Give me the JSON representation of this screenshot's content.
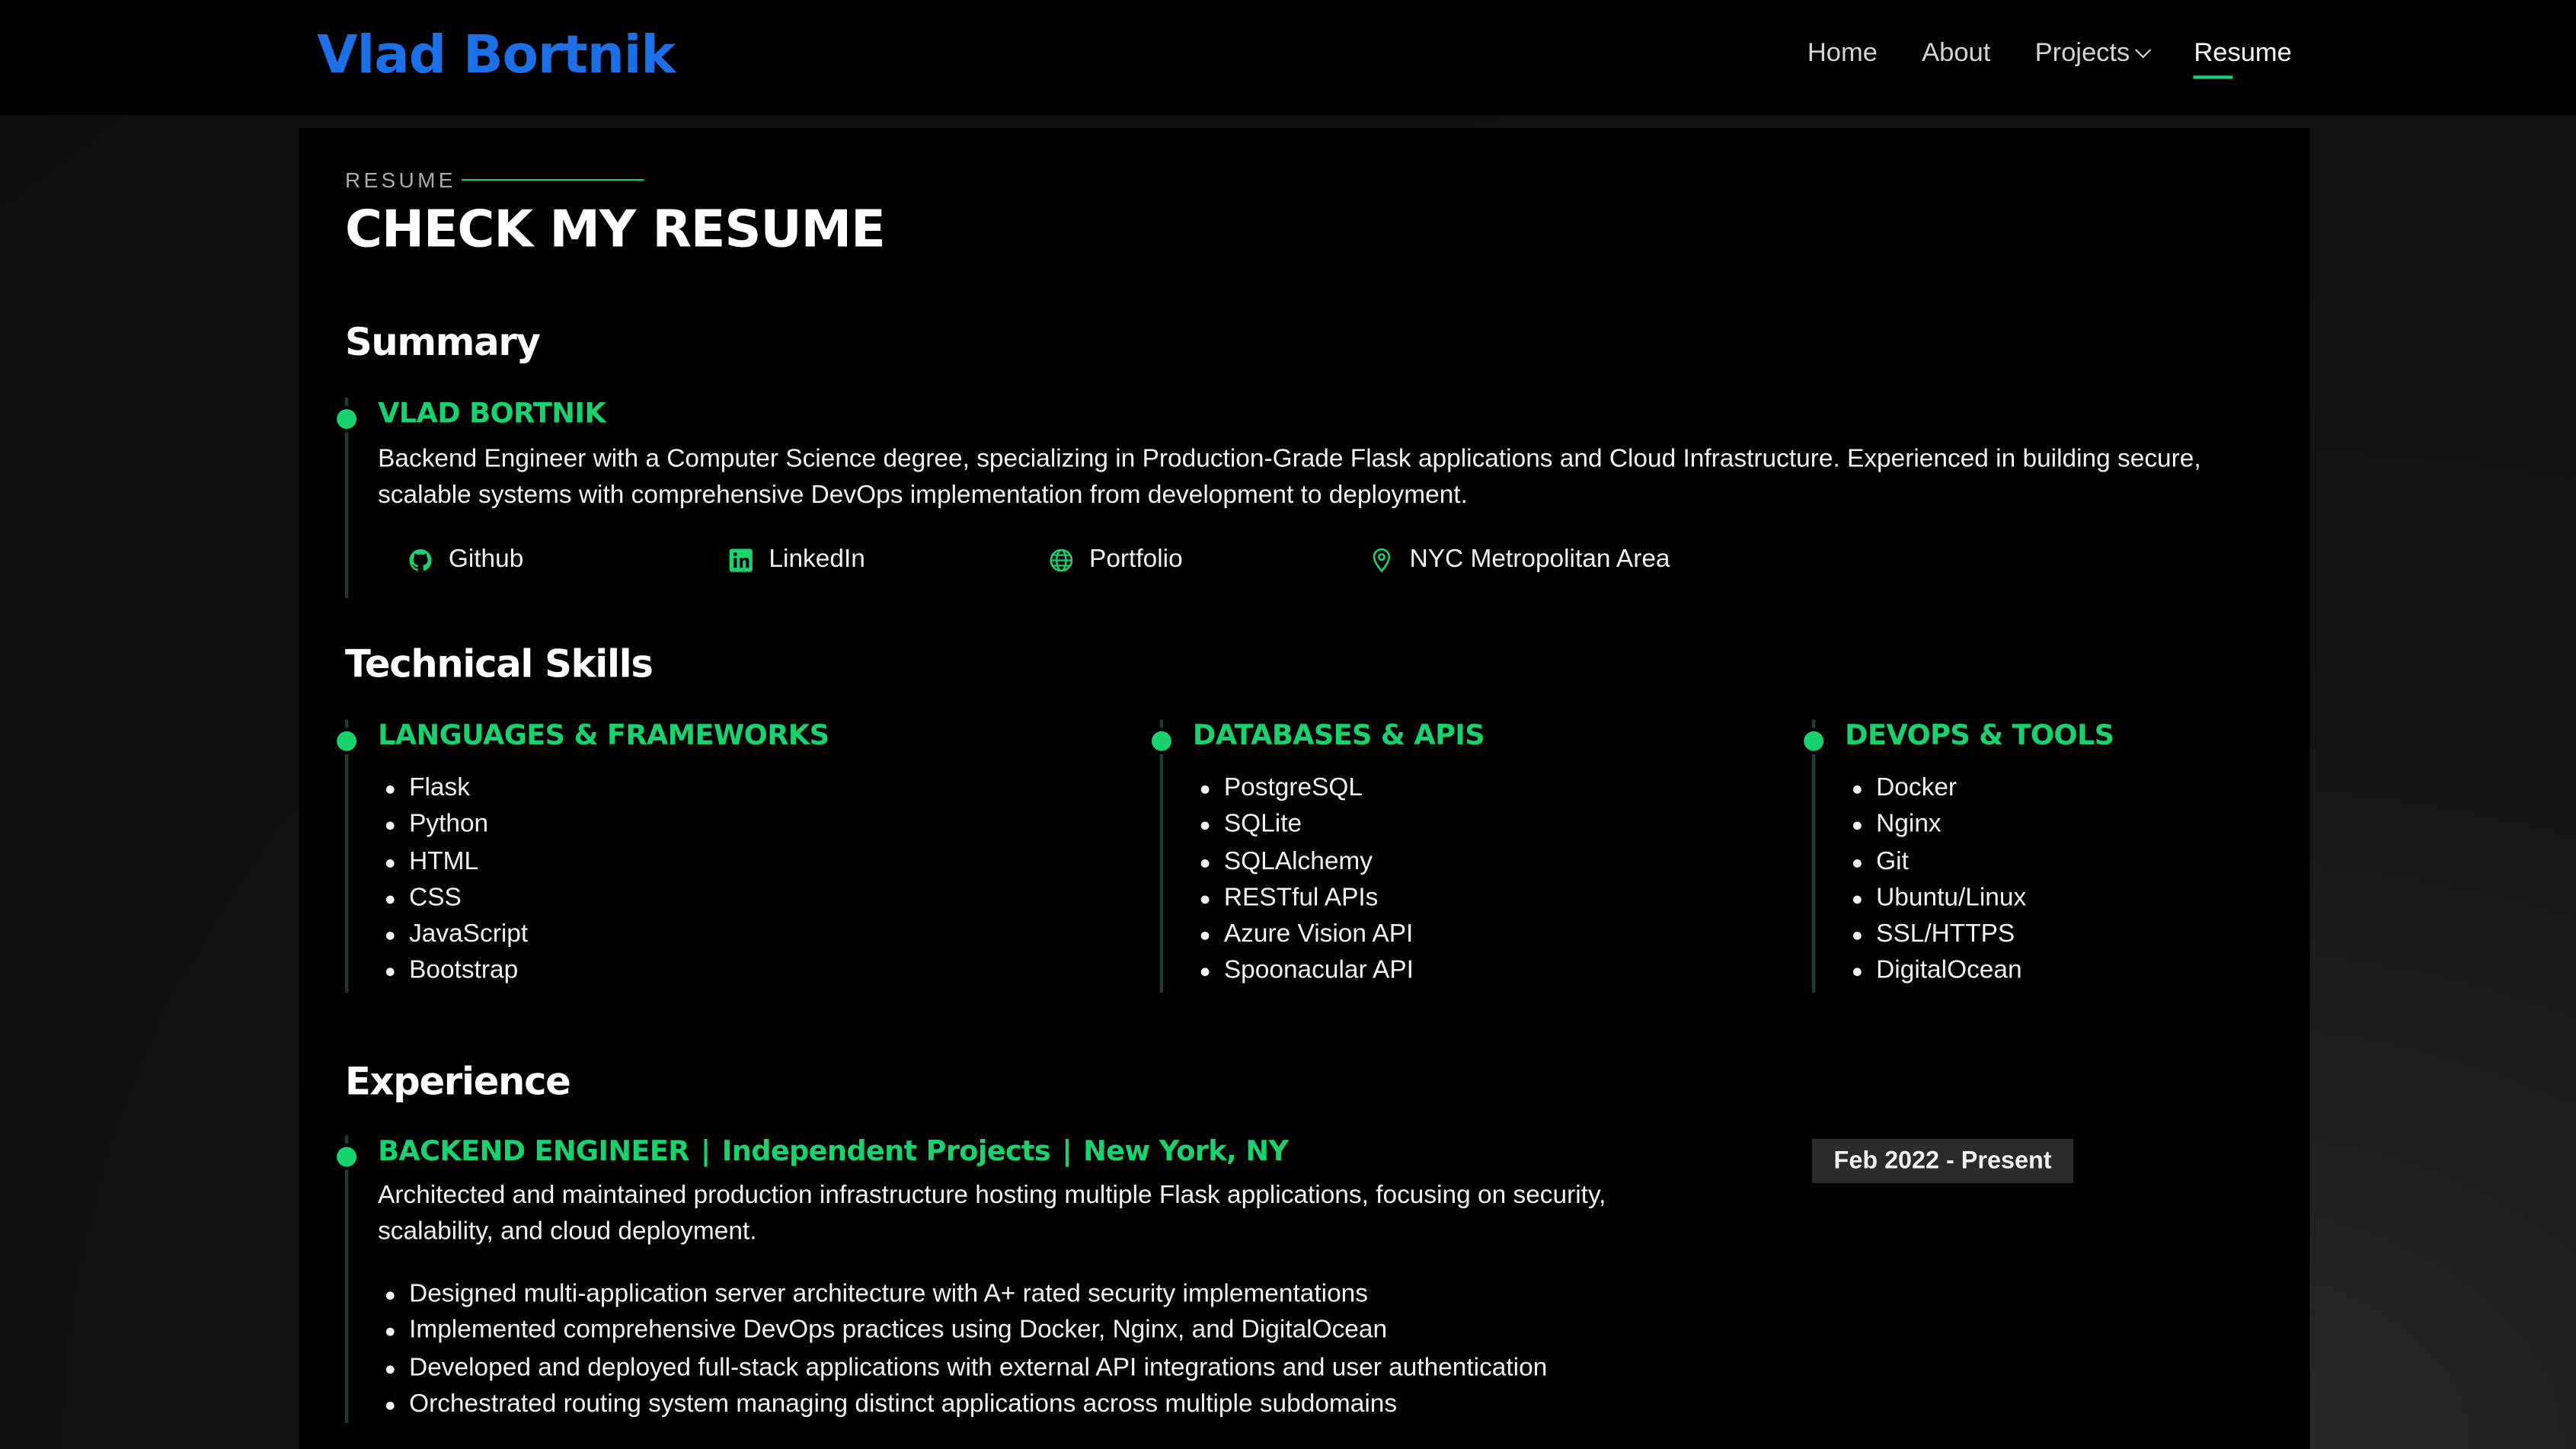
{
  "header": {
    "logo": "Vlad Bortnik",
    "nav": [
      {
        "label": "Home"
      },
      {
        "label": "About"
      },
      {
        "label": "Projects"
      },
      {
        "label": "Resume"
      }
    ],
    "active_nav": "Resume"
  },
  "resume": {
    "kicker": "RESUME",
    "title": "CHECK MY RESUME",
    "summary": {
      "heading": "Summary",
      "name": "VLAD BORTNIK",
      "text": "Backend Engineer with a Computer Science degree, specializing in Production-Grade Flask applications and Cloud Infrastructure. Experienced in building secure, scalable systems with comprehensive DevOps implementation from development to deployment.",
      "contacts": [
        {
          "label": "Github",
          "icon": "github-icon"
        },
        {
          "label": "LinkedIn",
          "icon": "linkedin-icon"
        },
        {
          "label": "Portfolio",
          "icon": "globe-icon"
        },
        {
          "label": "NYC Metropolitan Area",
          "icon": "map-pin-icon"
        }
      ]
    },
    "skills": {
      "heading": "Technical Skills",
      "groups": [
        {
          "title": "LANGUAGES & FRAMEWORKS",
          "items": [
            "Flask",
            "Python",
            "HTML",
            "CSS",
            "JavaScript",
            "Bootstrap"
          ]
        },
        {
          "title": "DATABASES & APIS",
          "items": [
            "PostgreSQL",
            "SQLite",
            "SQLAlchemy",
            "RESTful APIs",
            "Azure Vision API",
            "Spoonacular API"
          ]
        },
        {
          "title": "DEVOPS & TOOLS",
          "items": [
            "Docker",
            "Nginx",
            "Git",
            "Ubuntu/Linux",
            "SSL/HTTPS",
            "DigitalOcean"
          ]
        }
      ]
    },
    "experience": {
      "heading": "Experience",
      "role": "BACKEND ENGINEER",
      "company": "Independent Projects",
      "location": "New York, NY",
      "separator": "|",
      "dates": "Feb 2022 - Present",
      "description": "Architected and maintained production infrastructure hosting multiple Flask applications, focusing on security, scalability, and cloud deployment.",
      "bullets": [
        "Designed multi-application server architecture with A+ rated security implementations",
        "Implemented comprehensive DevOps practices using Docker, Nginx, and DigitalOcean",
        "Developed and deployed full-stack applications with external API integrations and user authentication",
        "Orchestrated routing system managing distinct applications across multiple subdomains"
      ]
    }
  },
  "colors": {
    "accent": "#18d26e",
    "logo": "#1d6fe8",
    "background": "#000000",
    "badge": "#2b2b2b"
  }
}
